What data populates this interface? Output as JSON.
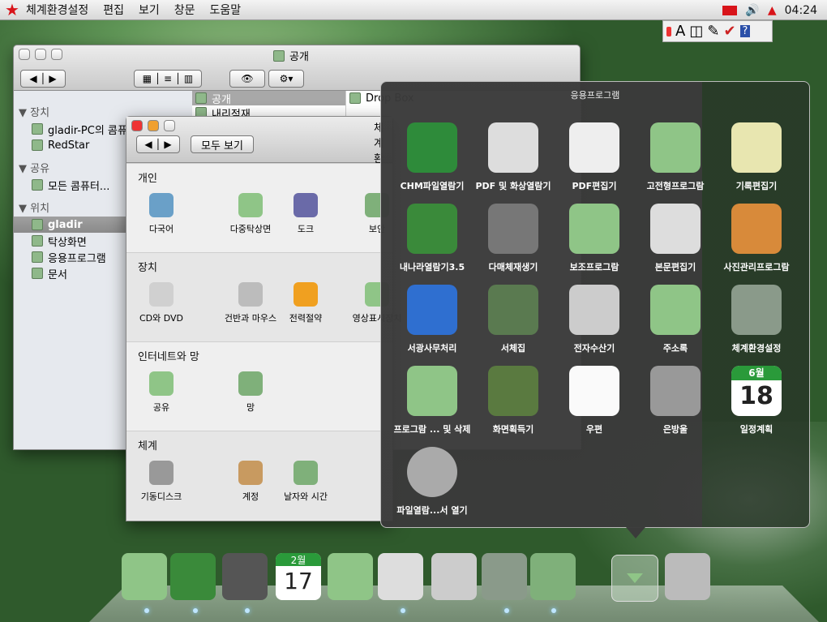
{
  "menubar": {
    "items": [
      "체계환경설정",
      "편집",
      "보기",
      "창문",
      "도움말"
    ],
    "clock": "04:24"
  },
  "mini_panel": {
    "letter": "A"
  },
  "finder": {
    "title": "공개",
    "sidebar": [
      {
        "header": "장치",
        "items": [
          "gladir-PC의 콤퓨터",
          "RedStar"
        ]
      },
      {
        "header": "공유",
        "items": [
          "모든 콤퓨터..."
        ]
      },
      {
        "header": "위치",
        "items": [
          "gladir",
          "탁상화면",
          "응용프로그램",
          "문서"
        ]
      }
    ],
    "column1": [
      "공개",
      "내리적재"
    ],
    "column2": [
      "Drop Box"
    ],
    "selected_sidebar": "gladir"
  },
  "prefs": {
    "title": "체계환경설정",
    "show_all": "모두 보기",
    "sections": [
      {
        "title": "개인",
        "items": [
          "다국어",
          "다중탁상면",
          "도크",
          "보안"
        ]
      },
      {
        "title": "장치",
        "items": [
          "CD와 DVD",
          "건반과 마우스",
          "전력절약",
          "영상표시장치"
        ]
      },
      {
        "title": "인터네트와 망",
        "items": [
          "공유",
          "망"
        ]
      },
      {
        "title": "체계",
        "items": [
          "기동디스크",
          "계정",
          "날자와 시간"
        ]
      }
    ]
  },
  "apps": {
    "title": "응용프로그램",
    "items": [
      "CHM파일열람기",
      "PDF 및 화상열람기",
      "PDF편집기",
      "고전형프로그람",
      "기록편집기",
      "내나라열람기3.5",
      "다매체재생기",
      "보조프로그람",
      "본문편집기",
      "사진관리프로그람",
      "서광사무처리",
      "서체집",
      "전자수산기",
      "주소록",
      "체계환경설정",
      "프로그람 ... 및 삭제",
      "화면획득기",
      "우편",
      "은방울",
      "일정계획",
      "파일열람...서 열기"
    ],
    "calendar": {
      "month": "6월",
      "day": "18"
    }
  },
  "dock": {
    "calendar": {
      "month": "2월",
      "day": "17"
    }
  },
  "colors": {
    "accent": "#d8141a",
    "folder_green": "#8fc587",
    "panel": "#3a3a3a"
  }
}
